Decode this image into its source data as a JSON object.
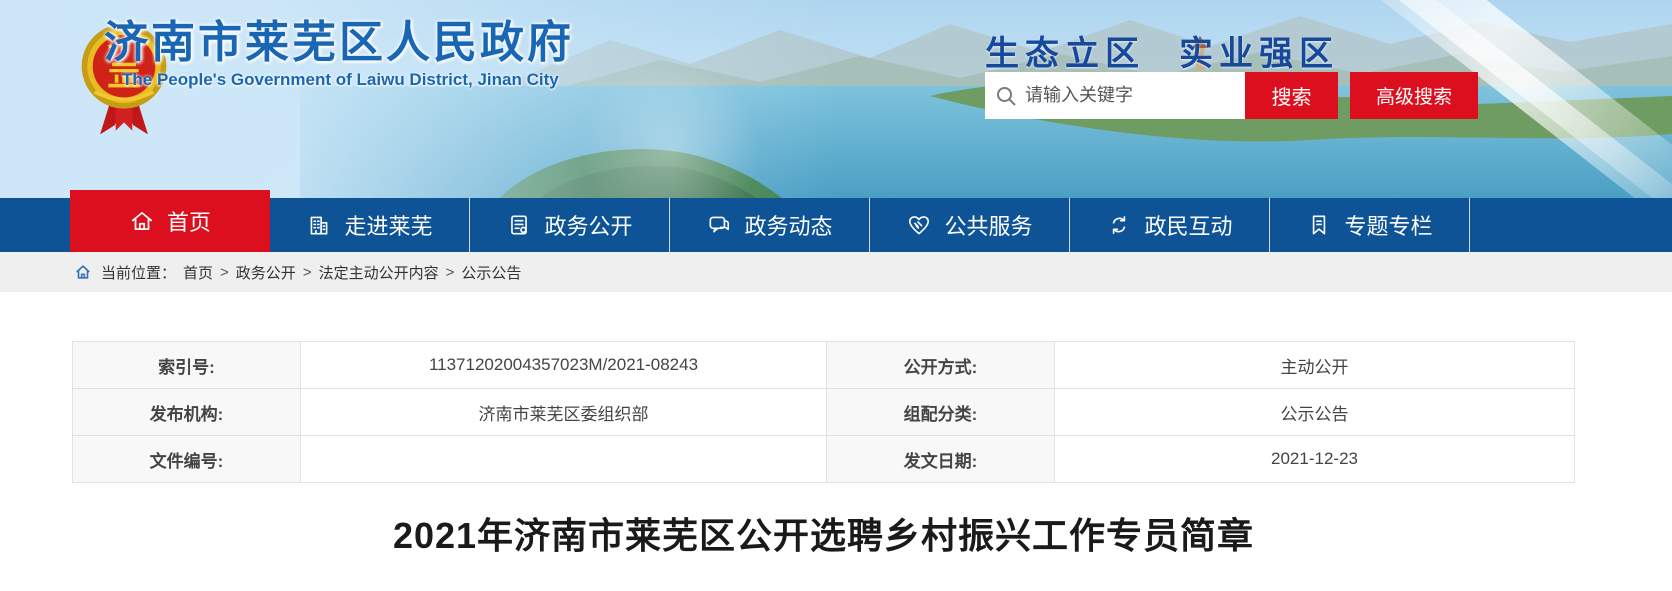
{
  "header": {
    "site_name": "济南市莱芜区人民政府",
    "site_name_en": "The People's Government of Laiwu District, Jinan City",
    "slogan": {
      "part1": "生态立区",
      "part2": "实业强区"
    },
    "search": {
      "placeholder": "请输入关键字",
      "search_button": "搜索",
      "advanced_button": "高级搜索"
    }
  },
  "nav": {
    "items": [
      {
        "label": "首页",
        "icon": "home-icon",
        "active": true
      },
      {
        "label": "走进莱芜",
        "icon": "building-icon",
        "active": false
      },
      {
        "label": "政务公开",
        "icon": "document-icon",
        "active": false
      },
      {
        "label": "政务动态",
        "icon": "chat-icon",
        "active": false
      },
      {
        "label": "公共服务",
        "icon": "service-heart-icon",
        "active": false
      },
      {
        "label": "政民互动",
        "icon": "interaction-arrows-icon",
        "active": false
      },
      {
        "label": "专题专栏",
        "icon": "bookmark-icon",
        "active": false
      }
    ]
  },
  "breadcrumb": {
    "location_label": "当前位置：",
    "separator": ">",
    "items": [
      "首页",
      "政务公开",
      "法定主动公开内容",
      "公示公告"
    ]
  },
  "meta_table": {
    "rows": [
      {
        "label_left": "索引号:",
        "value_left": "11371202004357023M/2021-08243",
        "label_right": "公开方式:",
        "value_right": "主动公开"
      },
      {
        "label_left": "发布机构:",
        "value_left": "济南市莱芜区委组织部",
        "label_right": "组配分类:",
        "value_right": "公示公告"
      },
      {
        "label_left": "文件编号:",
        "value_left": "",
        "label_right": "发文日期:",
        "value_right": "2021-12-23"
      }
    ]
  },
  "article": {
    "title": "2021年济南市莱芜区公开选聘乡村振兴工作专员简章"
  },
  "colors": {
    "nav_blue": "#0d5396",
    "accent_red": "#dc0f1e",
    "site_title_blue": "#1966b4",
    "slogan_blue": "#16489d",
    "breadcrumb_bg": "#efefef",
    "table_border": "#e2e2e2",
    "table_label_bg": "#f8f8f8"
  }
}
